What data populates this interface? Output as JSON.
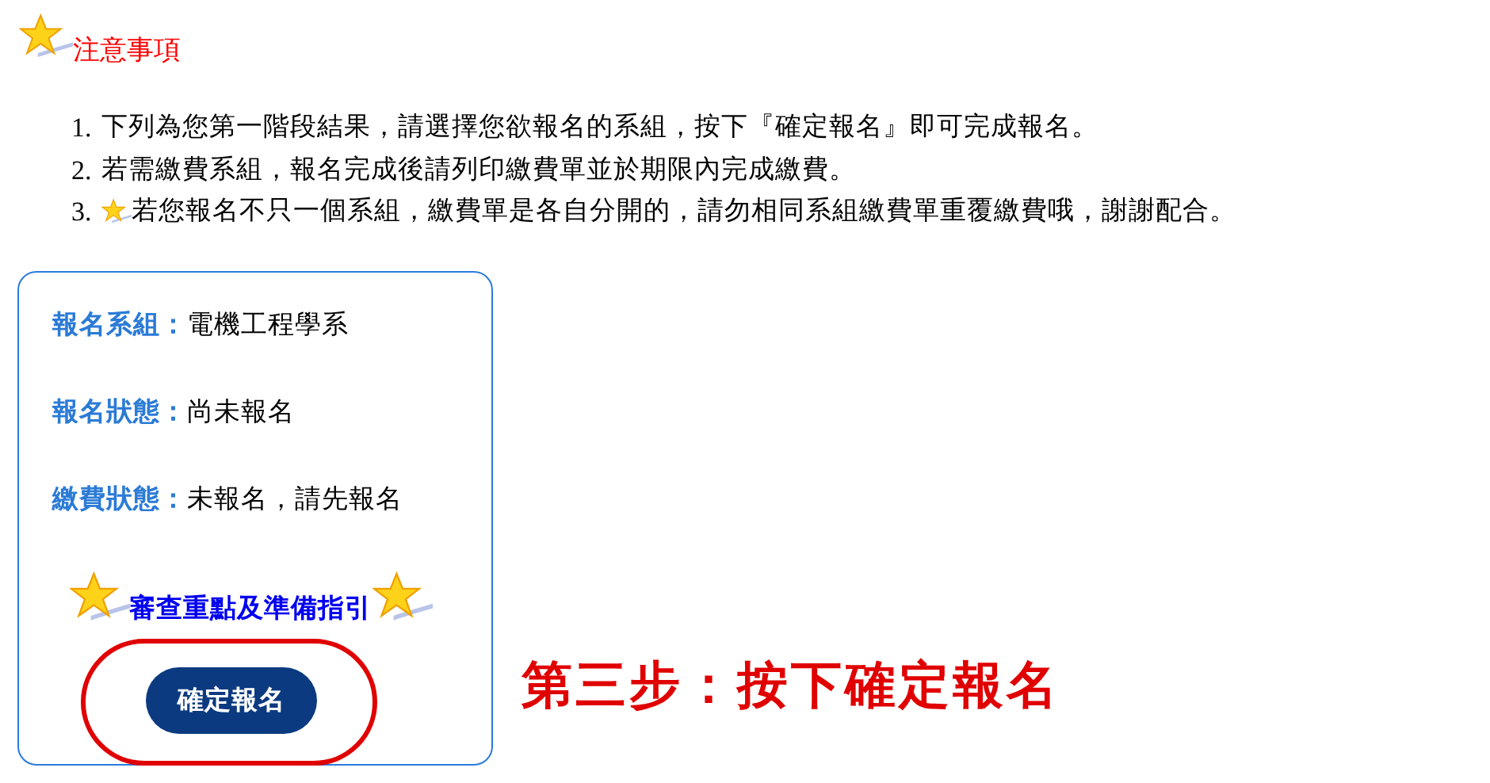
{
  "notice": {
    "title": "注意事項"
  },
  "items": [
    {
      "number": "1.",
      "text": "下列為您第一階段結果，請選擇您欲報名的系組，按下『確定報名』即可完成報名。",
      "star": false
    },
    {
      "number": "2.",
      "text": "若需繳費系組，報名完成後請列印繳費單並於期限內完成繳費。",
      "star": false
    },
    {
      "number": "3.",
      "text": "若您報名不只一個系組，繳費單是各自分開的，請勿相同系組繳費單重覆繳費哦，謝謝配合。",
      "star": true
    }
  ],
  "card": {
    "fields": [
      {
        "label": "報名系組：",
        "value": "電機工程學系"
      },
      {
        "label": "報名狀態：",
        "value": "尚未報名"
      },
      {
        "label": "繳費狀態：",
        "value": "未報名，請先報名"
      }
    ],
    "guide_link": "審查重點及準備指引",
    "button": "確定報名"
  },
  "annotation": "第三步：按下確定報名"
}
